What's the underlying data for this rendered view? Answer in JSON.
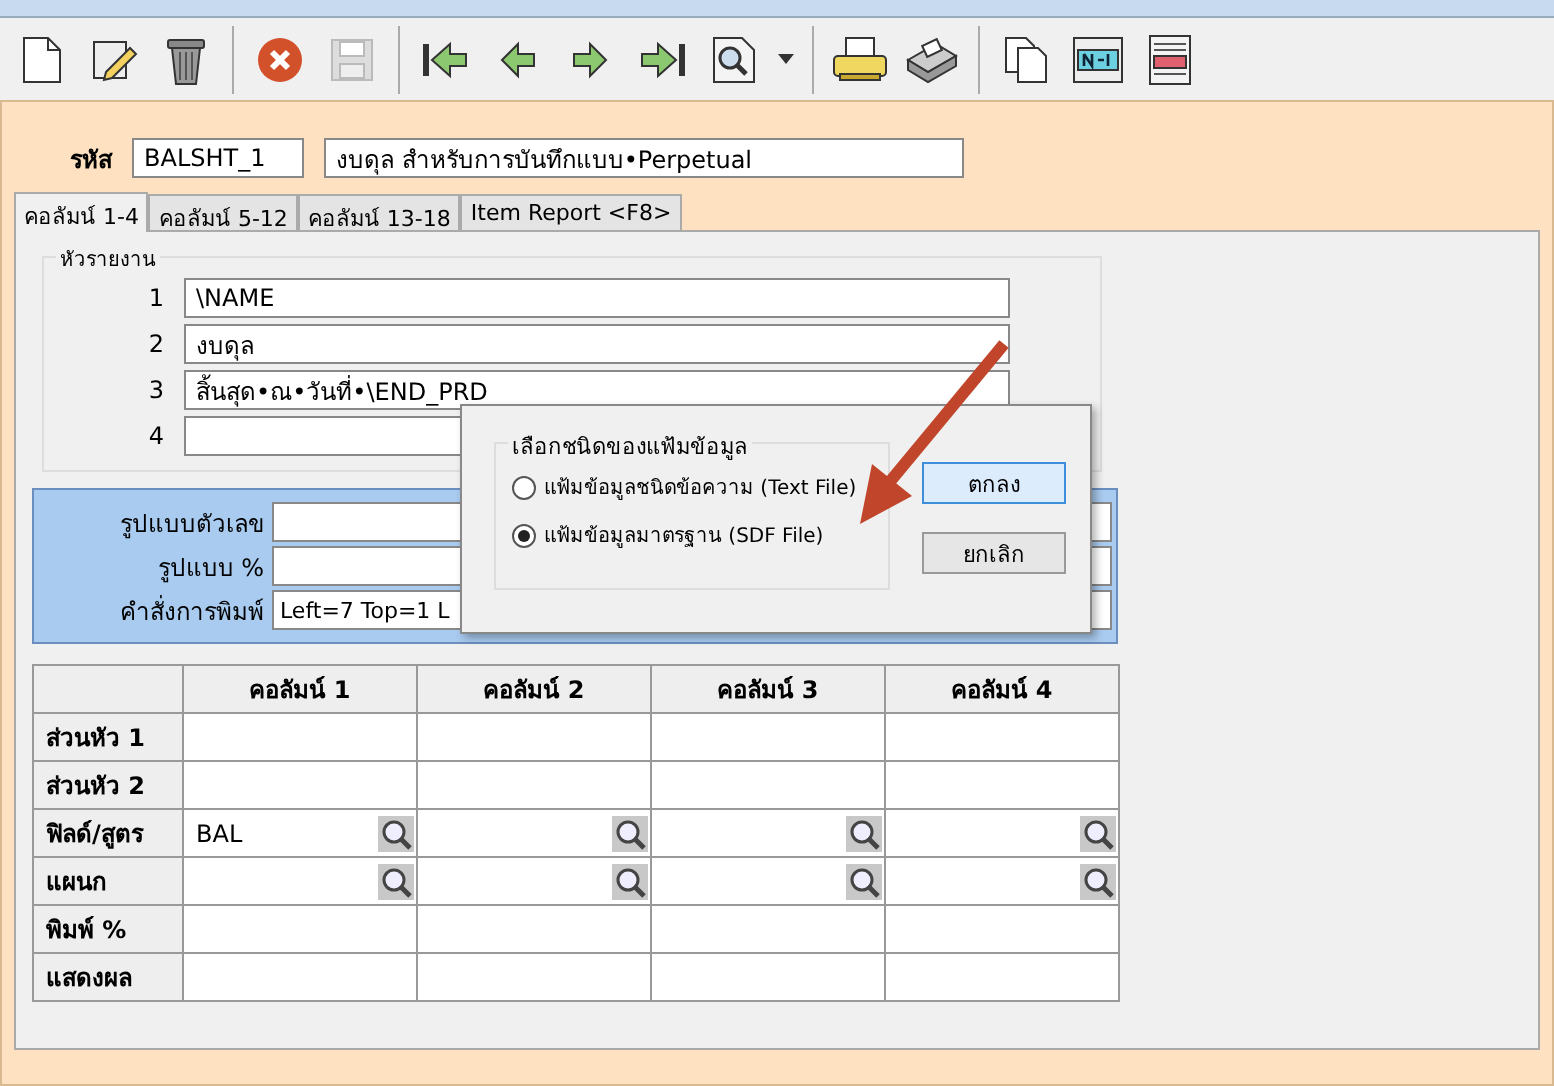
{
  "toolbar": {
    "buttons": [
      {
        "kind": "new"
      },
      {
        "kind": "edit"
      },
      {
        "kind": "delete"
      },
      {
        "kind": "sep"
      },
      {
        "kind": "cancel"
      },
      {
        "kind": "save",
        "disabled": true
      },
      {
        "kind": "sep"
      },
      {
        "kind": "first"
      },
      {
        "kind": "prev"
      },
      {
        "kind": "next"
      },
      {
        "kind": "last"
      },
      {
        "kind": "find"
      },
      {
        "kind": "dropdown"
      },
      {
        "kind": "sep"
      },
      {
        "kind": "print"
      },
      {
        "kind": "fax"
      },
      {
        "kind": "sep"
      },
      {
        "kind": "copy"
      },
      {
        "kind": "note"
      },
      {
        "kind": "form"
      }
    ]
  },
  "code": {
    "label": "รหัส",
    "value": "BALSHT_1",
    "description": "งบดุล สำหรับการบันทึกแบบ•Perpetual"
  },
  "tabs": [
    {
      "label": "คอลัมน์ 1-4",
      "selected": true
    },
    {
      "label": "คอลัมน์ 5-12",
      "selected": false
    },
    {
      "label": "คอลัมน์ 13-18",
      "selected": false
    },
    {
      "label": "Item Report <F8>",
      "selected": false
    }
  ],
  "report_header": {
    "title": "หัวรายงาน",
    "lines": [
      {
        "number": "1",
        "value": "\\NAME"
      },
      {
        "number": "2",
        "value": "งบดุล"
      },
      {
        "number": "3",
        "value": "สิ้นสุด•ณ•วันที่•\\END_PRD"
      },
      {
        "number": "4"
      }
    ]
  },
  "format": {
    "fields": [
      {
        "label": "รูปแบบตัวเลข"
      },
      {
        "label": "รูปแบบ %"
      },
      {
        "label": "คำสั่งการพิมพ์",
        "value": "Left=7 Top=1 L"
      }
    ]
  },
  "grid": {
    "columns": [
      "คอลัมน์ 1",
      "คอลัมน์ 2",
      "คอลัมน์ 3",
      "คอลัมน์ 4"
    ],
    "rows": [
      {
        "label": "ส่วนหัว 1",
        "lookup": false,
        "cells": [
          "",
          "",
          "",
          ""
        ]
      },
      {
        "label": "ส่วนหัว 2",
        "lookup": false,
        "cells": [
          "",
          "",
          "",
          ""
        ]
      },
      {
        "label": "ฟิลด์/สูตร",
        "lookup": true,
        "cells": [
          "BAL",
          "",
          "",
          ""
        ]
      },
      {
        "label": "แผนก",
        "lookup": true,
        "cells": [
          "",
          "",
          "",
          ""
        ]
      },
      {
        "label": "พิมพ์ %",
        "lookup": false,
        "cells": [
          "",
          "",
          "",
          ""
        ]
      },
      {
        "label": "แสดงผล",
        "lookup": false,
        "cells": [
          "",
          "",
          "",
          ""
        ]
      }
    ]
  },
  "dialog": {
    "group_title": "เลือกชนิดของแฟ้มข้อมูล",
    "options": [
      {
        "label": "แฟ้มข้อมูลชนิดข้อความ (Text File)",
        "selected": false
      },
      {
        "label": "แฟ้มข้อมูลมาตรฐาน (SDF File)",
        "selected": true
      }
    ],
    "buttons": [
      {
        "label": "ตกลง",
        "default": true
      },
      {
        "label": "ยกเลิก",
        "default": false
      }
    ]
  }
}
